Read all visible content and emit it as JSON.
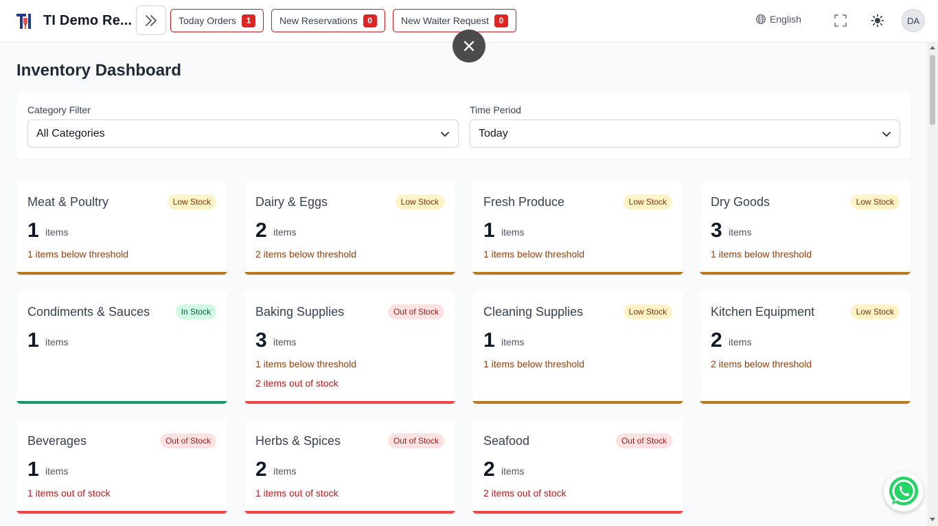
{
  "header": {
    "brand": "TI Demo Re...",
    "pills": [
      {
        "label": "Today Orders",
        "count": "1"
      },
      {
        "label": "New Reservations",
        "count": "0"
      },
      {
        "label": "New Waiter Request",
        "count": "0"
      }
    ],
    "language": "English",
    "avatar_initials": "DA"
  },
  "page": {
    "title": "Inventory Dashboard"
  },
  "filters": {
    "category_label": "Category Filter",
    "category_value": "All Categories",
    "period_label": "Time Period",
    "period_value": "Today"
  },
  "units": {
    "items": "items"
  },
  "cards": [
    {
      "name": "Meat & Poultry",
      "status": "Low Stock",
      "count": "1",
      "line1": "1 items below threshold",
      "line2": ""
    },
    {
      "name": "Dairy & Eggs",
      "status": "Low Stock",
      "count": "2",
      "line1": "2 items below threshold",
      "line2": ""
    },
    {
      "name": "Fresh Produce",
      "status": "Low Stock",
      "count": "1",
      "line1": "1 items below threshold",
      "line2": ""
    },
    {
      "name": "Dry Goods",
      "status": "Low Stock",
      "count": "3",
      "line1": "1 items below threshold",
      "line2": ""
    },
    {
      "name": "Condiments & Sauces",
      "status": "In Stock",
      "count": "1",
      "line1": "",
      "line2": ""
    },
    {
      "name": "Baking Supplies",
      "status": "Out of Stock",
      "count": "3",
      "line1": "1 items below threshold",
      "line2": "2 items out of stock"
    },
    {
      "name": "Cleaning Supplies",
      "status": "Low Stock",
      "count": "1",
      "line1": "1 items below threshold",
      "line2": ""
    },
    {
      "name": "Kitchen Equipment",
      "status": "Low Stock",
      "count": "2",
      "line1": "2 items below threshold",
      "line2": ""
    },
    {
      "name": "Beverages",
      "status": "Out of Stock",
      "count": "1",
      "line1": "1 items out of stock",
      "line2": ""
    },
    {
      "name": "Herbs & Spices",
      "status": "Out of Stock",
      "count": "2",
      "line1": "1 items out of stock",
      "line2": ""
    },
    {
      "name": "Seafood",
      "status": "Out of Stock",
      "count": "2",
      "line1": "2 items out of stock",
      "line2": ""
    }
  ],
  "colors": {
    "low_bar": "#b7791f",
    "in_bar": "#16966b",
    "out_bar": "#ef4444",
    "pill_border": "#b91c1c",
    "badge": "#dc2626"
  }
}
